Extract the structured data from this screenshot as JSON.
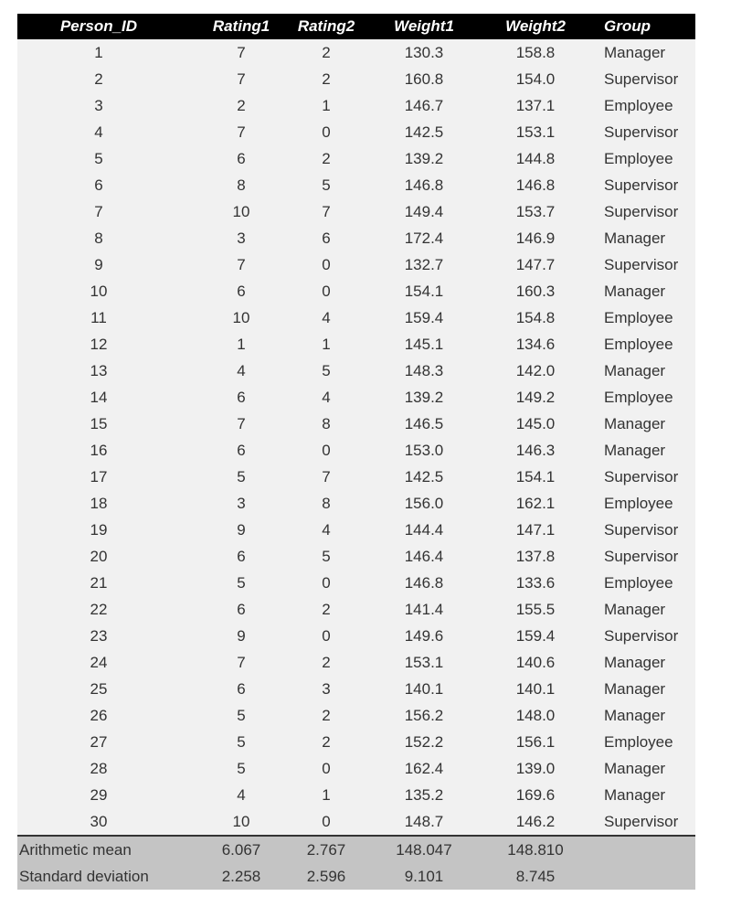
{
  "table": {
    "headers": [
      "Person_ID",
      "Rating1",
      "Rating2",
      "Weight1",
      "Weight2",
      "Group"
    ],
    "rows": [
      [
        "1",
        "7",
        "2",
        "130.3",
        "158.8",
        "Manager"
      ],
      [
        "2",
        "7",
        "2",
        "160.8",
        "154.0",
        "Supervisor"
      ],
      [
        "3",
        "2",
        "1",
        "146.7",
        "137.1",
        "Employee"
      ],
      [
        "4",
        "7",
        "0",
        "142.5",
        "153.1",
        "Supervisor"
      ],
      [
        "5",
        "6",
        "2",
        "139.2",
        "144.8",
        "Employee"
      ],
      [
        "6",
        "8",
        "5",
        "146.8",
        "146.8",
        "Supervisor"
      ],
      [
        "7",
        "10",
        "7",
        "149.4",
        "153.7",
        "Supervisor"
      ],
      [
        "8",
        "3",
        "6",
        "172.4",
        "146.9",
        "Manager"
      ],
      [
        "9",
        "7",
        "0",
        "132.7",
        "147.7",
        "Supervisor"
      ],
      [
        "10",
        "6",
        "0",
        "154.1",
        "160.3",
        "Manager"
      ],
      [
        "11",
        "10",
        "4",
        "159.4",
        "154.8",
        "Employee"
      ],
      [
        "12",
        "1",
        "1",
        "145.1",
        "134.6",
        "Employee"
      ],
      [
        "13",
        "4",
        "5",
        "148.3",
        "142.0",
        "Manager"
      ],
      [
        "14",
        "6",
        "4",
        "139.2",
        "149.2",
        "Employee"
      ],
      [
        "15",
        "7",
        "8",
        "146.5",
        "145.0",
        "Manager"
      ],
      [
        "16",
        "6",
        "0",
        "153.0",
        "146.3",
        "Manager"
      ],
      [
        "17",
        "5",
        "7",
        "142.5",
        "154.1",
        "Supervisor"
      ],
      [
        "18",
        "3",
        "8",
        "156.0",
        "162.1",
        "Employee"
      ],
      [
        "19",
        "9",
        "4",
        "144.4",
        "147.1",
        "Supervisor"
      ],
      [
        "20",
        "6",
        "5",
        "146.4",
        "137.8",
        "Supervisor"
      ],
      [
        "21",
        "5",
        "0",
        "146.8",
        "133.6",
        "Employee"
      ],
      [
        "22",
        "6",
        "2",
        "141.4",
        "155.5",
        "Manager"
      ],
      [
        "23",
        "9",
        "0",
        "149.6",
        "159.4",
        "Supervisor"
      ],
      [
        "24",
        "7",
        "2",
        "153.1",
        "140.6",
        "Manager"
      ],
      [
        "25",
        "6",
        "3",
        "140.1",
        "140.1",
        "Manager"
      ],
      [
        "26",
        "5",
        "2",
        "156.2",
        "148.0",
        "Manager"
      ],
      [
        "27",
        "5",
        "2",
        "152.2",
        "156.1",
        "Employee"
      ],
      [
        "28",
        "5",
        "0",
        "162.4",
        "139.0",
        "Manager"
      ],
      [
        "29",
        "4",
        "1",
        "135.2",
        "169.6",
        "Manager"
      ],
      [
        "30",
        "10",
        "0",
        "148.7",
        "146.2",
        "Supervisor"
      ]
    ],
    "summary": [
      {
        "label": "Arithmetic mean",
        "values": [
          "6.067",
          "2.767",
          "148.047",
          "148.810"
        ]
      },
      {
        "label": "Standard deviation",
        "values": [
          "2.258",
          "2.596",
          "9.101",
          "8.745"
        ]
      }
    ]
  },
  "colors": {
    "header_bg": "#000000",
    "header_text": "#ffffff",
    "row_bg": "#f1f1f1",
    "summary_bg": "#c4c4c4"
  }
}
